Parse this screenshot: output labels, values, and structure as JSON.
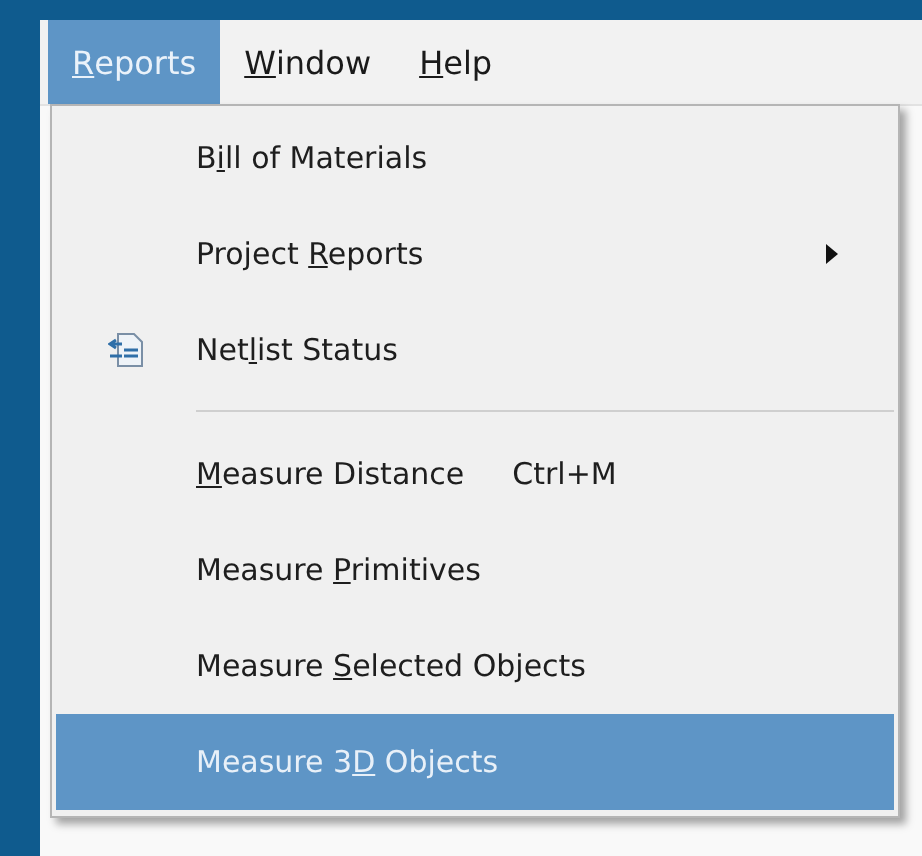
{
  "menu_bar": [
    {
      "label": {
        "key": "R",
        "after": "eports"
      },
      "selected": true
    },
    {
      "label": {
        "key": "W",
        "after": "indow"
      },
      "selected": false
    },
    {
      "label": {
        "key": "H",
        "after": "elp"
      },
      "selected": false
    }
  ],
  "menu": {
    "items": [
      {
        "kind": "item",
        "label": {
          "before": "B",
          "key": "i",
          "after": "ll of Materials"
        },
        "selected": false
      },
      {
        "kind": "submenu",
        "label": {
          "before": "Project ",
          "key": "R",
          "after": "eports"
        },
        "selected": false
      },
      {
        "kind": "icon_item",
        "label": {
          "before": "Net",
          "key": "l",
          "after": "ist Status"
        },
        "selected": false
      },
      {
        "kind": "separator"
      },
      {
        "kind": "item",
        "label": {
          "key": "M",
          "after": "easure Distance"
        },
        "shortcut": "Ctrl+M",
        "selected": false
      },
      {
        "kind": "item",
        "label": {
          "before": "Measure ",
          "key": "P",
          "after": "rimitives"
        },
        "selected": false
      },
      {
        "kind": "item",
        "label": {
          "before": "Measure ",
          "key": "S",
          "after": "elected Objects"
        },
        "selected": false
      },
      {
        "kind": "item",
        "label": {
          "before": "Measure 3",
          "key": "D",
          "after": " Objects"
        },
        "selected": true
      }
    ]
  }
}
